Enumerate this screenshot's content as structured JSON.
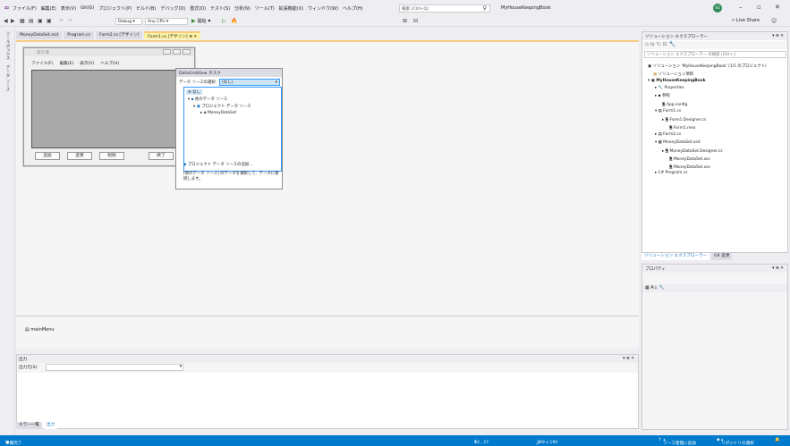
{
  "menu": {
    "items": [
      "ファイル(F)",
      "編集(E)",
      "表示(V)",
      "Git(G)",
      "プロジェクト(P)",
      "ビルド(B)",
      "デバッグ(D)",
      "書式(O)",
      "テスト(S)",
      "分析(N)",
      "ツール(T)",
      "拡張機能(X)",
      "ウィンドウ(W)",
      "ヘルプ(H)"
    ],
    "search_placeholder": "検索 (Ctrl+Q)",
    "solution_name": "MyHouseKeepingBook",
    "avatar_initials": "SG"
  },
  "toolbar": {
    "config": "Debug",
    "platform": "Any CPU",
    "start_label": "開始",
    "live_share": "Live Share"
  },
  "left_strip": [
    "ツールボックス",
    "データ ソース"
  ],
  "tabs": [
    {
      "label": "MoneyDataSet.xsd",
      "active": false
    },
    {
      "label": "Program.cs",
      "active": false
    },
    {
      "label": "Form2.cs [デザイン]",
      "active": false
    },
    {
      "label": "Form1.cs [デザイン]",
      "active": true
    }
  ],
  "form1": {
    "title": "家計簿",
    "menu": [
      "ファイル(F)",
      "編集(E)",
      "表示(V)",
      "ヘルプ(H)"
    ],
    "buttons": [
      "追加",
      "変更",
      "削除",
      "終了"
    ]
  },
  "taskpanel": {
    "title": "DataGridView タスク",
    "ds_label": "データ ソースの選択:",
    "ds_value": "(なし)",
    "tree": [
      {
        "label": "なし",
        "selected": true
      },
      {
        "label": "他のデータ ソース"
      },
      {
        "label": "プロジェクト データ ソース"
      },
      {
        "label": "MoneyDataSet"
      }
    ],
    "add_link": "プロジェクト データ ソースの追加...",
    "hint": "[他のデータ ソース] のデータを選択して、データに接続します。"
  },
  "tray": {
    "component": "mainMenu"
  },
  "output": {
    "title": "出力",
    "source_label": "出力元(S):",
    "tabs": [
      "エラー一覧",
      "出力"
    ]
  },
  "solution_explorer": {
    "title": "ソリューション エクスプローラー",
    "search_placeholder": "ソリューション エクスプローラー の検索 (Ctrl+;)",
    "items": [
      "ソリューション 'MyHouseKeepingBook' (1/1 のプロジェクト)",
      "ソリューション項目",
      "MyHouseKeepingBook",
      "Properties",
      "参照",
      "App.config",
      "Form1.cs",
      "Form1.Designer.cs",
      "Form1.resx",
      "Form2.cs",
      "MoneyDataSet.xsd",
      "MoneyDataSet.Designer.cs",
      "MoneyDataSet.xsc",
      "MoneyDataSet.xss",
      "Program.cs"
    ],
    "tabs": [
      "ソリューション エクスプローラー",
      "Git 変更"
    ]
  },
  "properties": {
    "title": "プロパティ"
  },
  "status": {
    "ready": "準備完了",
    "position": "13 , 27",
    "size": "259 x 190",
    "source_control": "ソース管理に追加",
    "repo": "リポジトリの選択"
  },
  "colors": {
    "accent": "#007acc",
    "tab_active": "#fff3a3",
    "grid": "#a9a9a9"
  }
}
